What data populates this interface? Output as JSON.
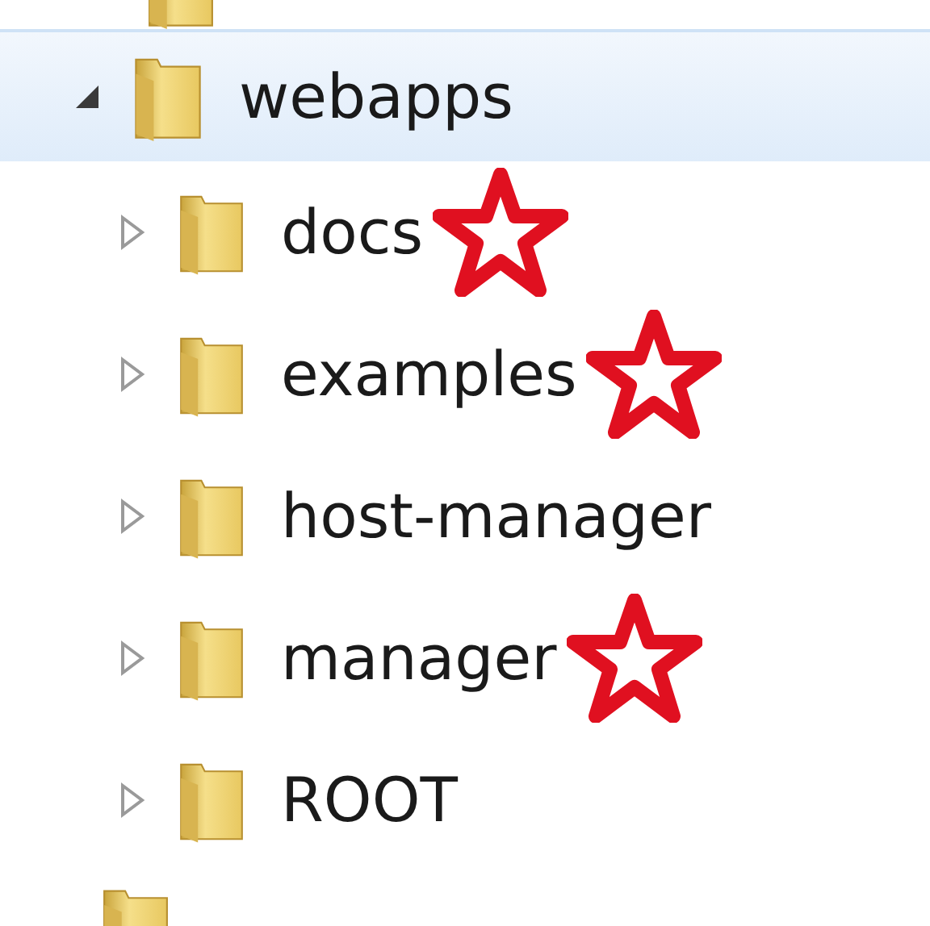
{
  "tree": {
    "root": {
      "label": "webapps",
      "expanded": true,
      "selected": true,
      "children": [
        {
          "label": "docs",
          "expanded": false,
          "starred": true
        },
        {
          "label": "examples",
          "expanded": false,
          "starred": true
        },
        {
          "label": "host-manager",
          "expanded": false,
          "starred": false
        },
        {
          "label": "manager",
          "expanded": false,
          "starred": true
        },
        {
          "label": "ROOT",
          "expanded": false,
          "starred": false
        }
      ]
    }
  }
}
